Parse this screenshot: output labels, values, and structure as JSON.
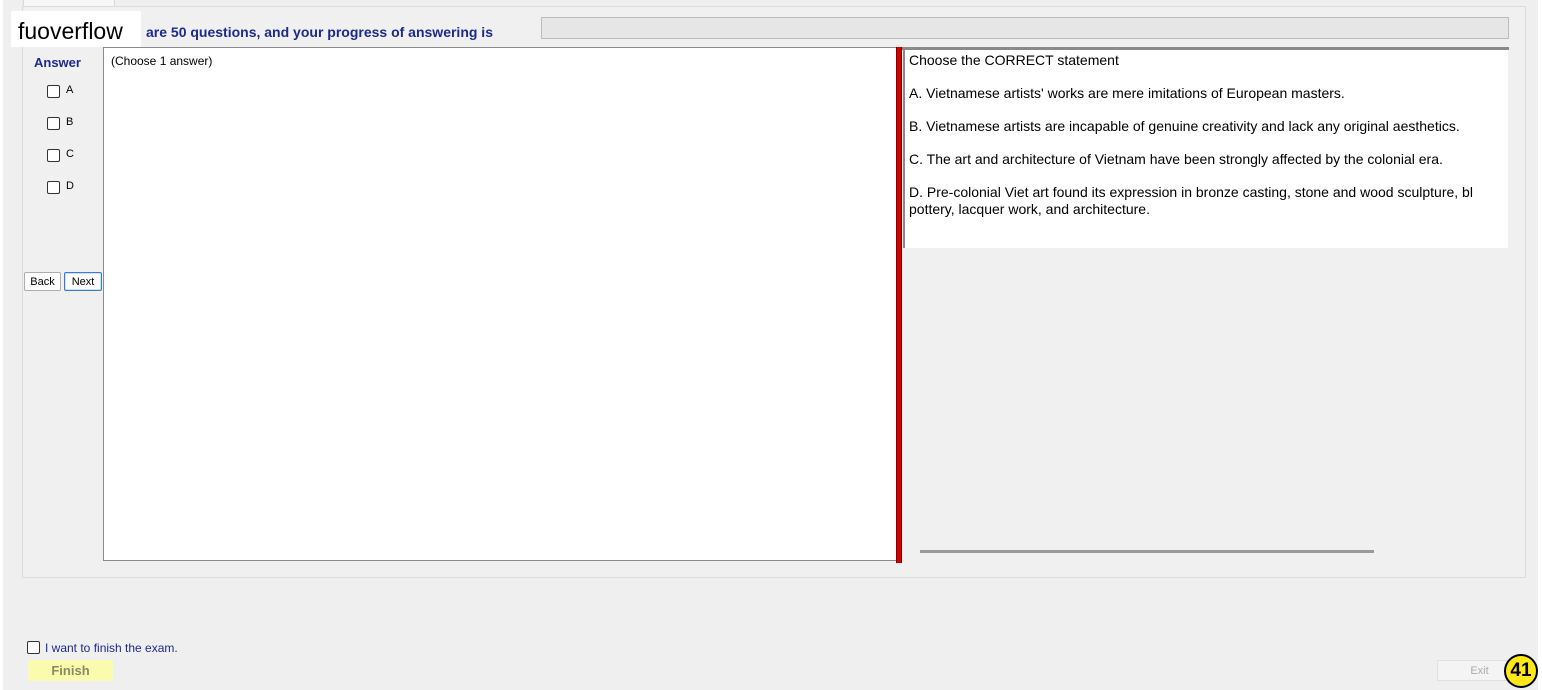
{
  "brand": "fuoverflow",
  "header": {
    "progress_text": "are 50 questions, and your progress of answering is",
    "progress_value": 0
  },
  "answer_panel": {
    "title": "Answer",
    "options": [
      "A",
      "B",
      "C",
      "D"
    ],
    "back_label": "Back",
    "next_label": "Next"
  },
  "answer_hint": "(Choose 1 answer)",
  "question": {
    "prompt": "Choose the CORRECT statement",
    "lines": [
      "A.  Vietnamese artists' works are mere imitations of European masters.",
      "B.  Vietnamese artists are incapable of genuine creativity and lack any original aesthetics.",
      "C.  The art and architecture of Vietnam have been strongly affected by the colonial era.",
      "D.  Pre-colonial Viet art found its expression in bronze casting, stone and wood sculpture, bl",
      "pottery, lacquer work, and architecture."
    ]
  },
  "footer": {
    "finish_check_label": "I want to finish the exam.",
    "finish_label": "Finish",
    "exit_label": "Exit",
    "badge": "41"
  },
  "colors": {
    "accent_text": "#1b2a8c",
    "splitter": "#d60000",
    "finish_bg": "#fbfbb0",
    "badge_bg": "#ffe81a"
  }
}
